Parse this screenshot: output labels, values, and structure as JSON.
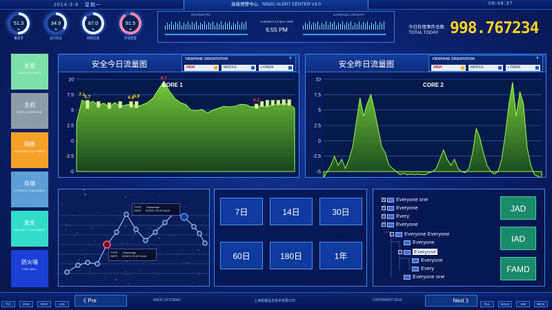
{
  "topbar": {
    "date": "2014-3-8",
    "weekday": "星期一",
    "title_cn": "高级预警中心",
    "title_en": "NSOC ALERT CENTER V3.0",
    "time": "08:48:37"
  },
  "gauges": [
    {
      "value": "51.3",
      "unit": "%",
      "label": "覆盖率",
      "percent": 51.3,
      "color": "#e6f4ff"
    },
    {
      "value": "34.9",
      "unit": "%",
      "label": "运行状态",
      "percent": 34.9,
      "color": "#e6f4ff"
    },
    {
      "value": "87.0",
      "unit": "%",
      "label": "网络流量",
      "percent": 87.0,
      "color": "#e6f4ff"
    },
    {
      "value": "91.5",
      "unit": "%",
      "label": "存储容量",
      "percent": 91.5,
      "color": "#ff8aa8"
    }
  ],
  "monitor": {
    "left_label": "SYSTEM TPC",
    "right_label": "STORAGE CAPACITY",
    "date": "TUESDAY,16 MAY 2040",
    "clock": "6:55 PM"
  },
  "todo": {
    "label_cn": "今日处理事件总数",
    "label_en": "TOTAL TODAY",
    "value": "998.767234"
  },
  "nav": [
    {
      "cn": "总览",
      "en": "DATA MAIN BASE",
      "color": "#7de0a8"
    },
    {
      "cn": "主机",
      "en": "HOST & TERMINAL",
      "color": "#8e9ca8"
    },
    {
      "cn": "网络",
      "en": "NETWORK EQUIPMENT",
      "color": "#f5a128"
    },
    {
      "cn": "存储",
      "en": "STORAGE EQUIPMENT",
      "color": "#5c9ed6"
    },
    {
      "cn": "安全",
      "en": "SECURITY EQUIPMENT",
      "color": "#33dcc8"
    },
    {
      "cn": "防火墙",
      "en": "FIRE WALL",
      "color": "#1a3fd6"
    }
  ],
  "viewpane": {
    "title": "VIEWPANE ORIGNTATION",
    "high": "HIGH",
    "middle": "MIDDLE",
    "lower": "LOWER"
  },
  "charts": {
    "today": {
      "title": "安全今日流量图",
      "core": "CORE 1"
    },
    "yesterday": {
      "title": "安全昨日流量图",
      "core": "CORE 2"
    }
  },
  "chart_data": [
    {
      "type": "area",
      "title": "CORE 1",
      "ylim": [
        -5,
        10
      ],
      "yticks": [
        10,
        7.5,
        5,
        2.5,
        0,
        -2.5,
        -5
      ],
      "x": [
        0,
        1,
        2,
        3,
        4,
        5,
        6,
        7,
        8,
        9,
        10,
        11,
        12,
        13,
        14,
        15,
        16,
        17,
        18,
        19,
        20,
        21,
        22,
        23,
        24,
        25,
        26,
        27,
        28,
        29,
        30,
        31,
        32,
        33,
        34,
        35,
        36,
        37,
        38,
        39,
        40
      ],
      "values": [
        3,
        6.6,
        6.1,
        6.4,
        5.8,
        6.1,
        5.5,
        6.2,
        5.6,
        5.8,
        6.0,
        5.6,
        5.8,
        6.2,
        6.9,
        8.3,
        9.7,
        8.1,
        6.9,
        6.2,
        5.9,
        5.0,
        4.9,
        5.1,
        4.5,
        5.0,
        5.3,
        5.6,
        5.5,
        5.6,
        5.9,
        5.9,
        5.5,
        5.6,
        5.6,
        5.5,
        5.9,
        5.8,
        6.1,
        5.9,
        5.3
      ],
      "labels": [
        {
          "x": 1,
          "y": 7.1,
          "text": "7.1",
          "color": "#ffd21e"
        },
        {
          "x": 2,
          "y": 6.7,
          "text": "6.7",
          "color": "#ffd21e"
        },
        {
          "x": 10,
          "y": 6.6,
          "text": "6.6",
          "color": "#ffd21e"
        },
        {
          "x": 11,
          "y": 6.8,
          "text": "6.8",
          "color": "#ffd21e"
        },
        {
          "x": 16,
          "y": 9.7,
          "text": "9.7",
          "color": "#ff4040"
        },
        {
          "x": 33,
          "y": 6.2,
          "text": "6.2",
          "color": "#ff4040"
        }
      ],
      "candles": [
        {
          "x": 2,
          "low": 5.2,
          "high": 6.6
        },
        {
          "x": 4,
          "low": 5.4,
          "high": 6.4
        },
        {
          "x": 6,
          "low": 5.2,
          "high": 6.2
        },
        {
          "x": 8,
          "low": 5.3,
          "high": 6.4
        },
        {
          "x": 10,
          "low": 5.4,
          "high": 6.4
        },
        {
          "x": 11,
          "low": 5.3,
          "high": 6.4
        },
        {
          "x": 16,
          "low": 8.7,
          "high": 9.4
        },
        {
          "x": 33,
          "low": 5.2,
          "high": 6.0
        },
        {
          "x": 34,
          "low": 5.5,
          "high": 6.4
        },
        {
          "x": 35,
          "low": 5.6,
          "high": 6.6
        },
        {
          "x": 36,
          "low": 5.7,
          "high": 6.6
        },
        {
          "x": 37,
          "low": 5.8,
          "high": 6.6
        },
        {
          "x": 38,
          "low": 5.8,
          "high": 6.7
        },
        {
          "x": 39,
          "low": 5.7,
          "high": 6.7
        }
      ]
    },
    {
      "type": "area",
      "title": "CORE 2",
      "ylim": [
        -5,
        10
      ],
      "yticks": [
        10,
        7.5,
        5,
        2.5,
        0,
        -2.5,
        -5
      ],
      "x": [
        0,
        1,
        2,
        3,
        4,
        5,
        6,
        7,
        8,
        9,
        10,
        11,
        12,
        13,
        14,
        15,
        16,
        17,
        18,
        19,
        20,
        21,
        22,
        23,
        24,
        25,
        26,
        27,
        28,
        29,
        30,
        31,
        32,
        33,
        34,
        35,
        36,
        37,
        38,
        39,
        40,
        41,
        42,
        43,
        44,
        45,
        46,
        47,
        48,
        49,
        50,
        51,
        52,
        53,
        54,
        55,
        56,
        57,
        58,
        59,
        60
      ],
      "values": [
        -6,
        -5,
        -4,
        -2.5,
        -4,
        -3,
        -4.5,
        -3,
        -1,
        3,
        7,
        4,
        6,
        7.5,
        5,
        2,
        -1,
        -2,
        -4,
        -4.5,
        -5,
        -5.5,
        -5.3,
        -5.5,
        -5.4,
        -5.5,
        -5.4,
        -5.5,
        -5.5,
        -5.2,
        -5,
        -4.5,
        -3,
        -1.5,
        -3,
        -4,
        -3,
        -4.5,
        -5,
        -5.2,
        -4.5,
        -2,
        2,
        0.5,
        -2,
        -4,
        -5,
        -5.4,
        -5,
        -3,
        1,
        6,
        9.5,
        4,
        8,
        6,
        -1,
        -4,
        -5.5,
        -5.8,
        -6
      ],
      "labels": [],
      "candles": []
    }
  ],
  "scatter_tooltip_1": {
    "type_label": "TYPE:",
    "type_value": "Espionage",
    "date_label": "DATE:",
    "date_value": "6/16/11 23:42:11pm"
  },
  "scatter_tooltip_2": {
    "type_label": "TYPE:",
    "type_value": "Espionage",
    "date_label": "DATE:",
    "date_value": "6/16/11 23:42:11pm"
  },
  "range_buttons": [
    "7日",
    "14日",
    "30日",
    "60日",
    "180日",
    "1年"
  ],
  "tree": [
    {
      "label": "Everyone one",
      "level": 0,
      "pm": "+"
    },
    {
      "label": "Everyone",
      "level": 0,
      "pm": "+"
    },
    {
      "label": "Every",
      "level": 0,
      "pm": "+"
    },
    {
      "label": "Everyone",
      "level": 0,
      "pm": "+"
    },
    {
      "label": "Everyone Everyone",
      "level": 1,
      "pm": "−"
    },
    {
      "label": "Everyone",
      "level": 2,
      "pm": ""
    },
    {
      "label": "Everyone",
      "level": 2,
      "pm": "−",
      "selected": true
    },
    {
      "label": "Everyone",
      "level": 3,
      "pm": ""
    },
    {
      "label": "Every",
      "level": 3,
      "pm": ""
    },
    {
      "label": "Everyone one",
      "level": 2,
      "pm": ""
    }
  ],
  "side_buttons": [
    "JAD",
    "IAD",
    "FAMD"
  ],
  "footer": {
    "left_tabs": [
      "TIC",
      "DAS",
      "DGO",
      "JAL"
    ],
    "right_tabs": [
      "FILL",
      "NAUZ",
      "VIM",
      "MICK"
    ],
    "prev": "Pre",
    "next": "Next",
    "system": "NSOC SYSTEMS",
    "company": "上海悦程信息技术有限公司",
    "copyright": "COPYRIGHT 2014"
  }
}
